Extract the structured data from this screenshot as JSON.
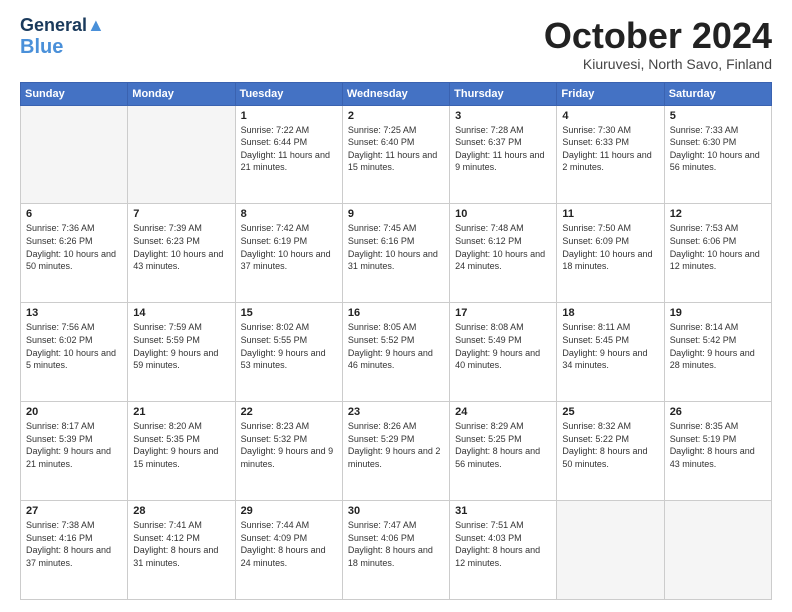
{
  "logo": {
    "line1": "General",
    "line2": "Blue"
  },
  "title": "October 2024",
  "subtitle": "Kiuruvesi, North Savo, Finland",
  "days_header": [
    "Sunday",
    "Monday",
    "Tuesday",
    "Wednesday",
    "Thursday",
    "Friday",
    "Saturday"
  ],
  "weeks": [
    [
      {
        "day": "",
        "text": ""
      },
      {
        "day": "",
        "text": ""
      },
      {
        "day": "1",
        "text": "Sunrise: 7:22 AM\nSunset: 6:44 PM\nDaylight: 11 hours and 21 minutes."
      },
      {
        "day": "2",
        "text": "Sunrise: 7:25 AM\nSunset: 6:40 PM\nDaylight: 11 hours and 15 minutes."
      },
      {
        "day": "3",
        "text": "Sunrise: 7:28 AM\nSunset: 6:37 PM\nDaylight: 11 hours and 9 minutes."
      },
      {
        "day": "4",
        "text": "Sunrise: 7:30 AM\nSunset: 6:33 PM\nDaylight: 11 hours and 2 minutes."
      },
      {
        "day": "5",
        "text": "Sunrise: 7:33 AM\nSunset: 6:30 PM\nDaylight: 10 hours and 56 minutes."
      }
    ],
    [
      {
        "day": "6",
        "text": "Sunrise: 7:36 AM\nSunset: 6:26 PM\nDaylight: 10 hours and 50 minutes."
      },
      {
        "day": "7",
        "text": "Sunrise: 7:39 AM\nSunset: 6:23 PM\nDaylight: 10 hours and 43 minutes."
      },
      {
        "day": "8",
        "text": "Sunrise: 7:42 AM\nSunset: 6:19 PM\nDaylight: 10 hours and 37 minutes."
      },
      {
        "day": "9",
        "text": "Sunrise: 7:45 AM\nSunset: 6:16 PM\nDaylight: 10 hours and 31 minutes."
      },
      {
        "day": "10",
        "text": "Sunrise: 7:48 AM\nSunset: 6:12 PM\nDaylight: 10 hours and 24 minutes."
      },
      {
        "day": "11",
        "text": "Sunrise: 7:50 AM\nSunset: 6:09 PM\nDaylight: 10 hours and 18 minutes."
      },
      {
        "day": "12",
        "text": "Sunrise: 7:53 AM\nSunset: 6:06 PM\nDaylight: 10 hours and 12 minutes."
      }
    ],
    [
      {
        "day": "13",
        "text": "Sunrise: 7:56 AM\nSunset: 6:02 PM\nDaylight: 10 hours and 5 minutes."
      },
      {
        "day": "14",
        "text": "Sunrise: 7:59 AM\nSunset: 5:59 PM\nDaylight: 9 hours and 59 minutes."
      },
      {
        "day": "15",
        "text": "Sunrise: 8:02 AM\nSunset: 5:55 PM\nDaylight: 9 hours and 53 minutes."
      },
      {
        "day": "16",
        "text": "Sunrise: 8:05 AM\nSunset: 5:52 PM\nDaylight: 9 hours and 46 minutes."
      },
      {
        "day": "17",
        "text": "Sunrise: 8:08 AM\nSunset: 5:49 PM\nDaylight: 9 hours and 40 minutes."
      },
      {
        "day": "18",
        "text": "Sunrise: 8:11 AM\nSunset: 5:45 PM\nDaylight: 9 hours and 34 minutes."
      },
      {
        "day": "19",
        "text": "Sunrise: 8:14 AM\nSunset: 5:42 PM\nDaylight: 9 hours and 28 minutes."
      }
    ],
    [
      {
        "day": "20",
        "text": "Sunrise: 8:17 AM\nSunset: 5:39 PM\nDaylight: 9 hours and 21 minutes."
      },
      {
        "day": "21",
        "text": "Sunrise: 8:20 AM\nSunset: 5:35 PM\nDaylight: 9 hours and 15 minutes."
      },
      {
        "day": "22",
        "text": "Sunrise: 8:23 AM\nSunset: 5:32 PM\nDaylight: 9 hours and 9 minutes."
      },
      {
        "day": "23",
        "text": "Sunrise: 8:26 AM\nSunset: 5:29 PM\nDaylight: 9 hours and 2 minutes."
      },
      {
        "day": "24",
        "text": "Sunrise: 8:29 AM\nSunset: 5:25 PM\nDaylight: 8 hours and 56 minutes."
      },
      {
        "day": "25",
        "text": "Sunrise: 8:32 AM\nSunset: 5:22 PM\nDaylight: 8 hours and 50 minutes."
      },
      {
        "day": "26",
        "text": "Sunrise: 8:35 AM\nSunset: 5:19 PM\nDaylight: 8 hours and 43 minutes."
      }
    ],
    [
      {
        "day": "27",
        "text": "Sunrise: 7:38 AM\nSunset: 4:16 PM\nDaylight: 8 hours and 37 minutes."
      },
      {
        "day": "28",
        "text": "Sunrise: 7:41 AM\nSunset: 4:12 PM\nDaylight: 8 hours and 31 minutes."
      },
      {
        "day": "29",
        "text": "Sunrise: 7:44 AM\nSunset: 4:09 PM\nDaylight: 8 hours and 24 minutes."
      },
      {
        "day": "30",
        "text": "Sunrise: 7:47 AM\nSunset: 4:06 PM\nDaylight: 8 hours and 18 minutes."
      },
      {
        "day": "31",
        "text": "Sunrise: 7:51 AM\nSunset: 4:03 PM\nDaylight: 8 hours and 12 minutes."
      },
      {
        "day": "",
        "text": ""
      },
      {
        "day": "",
        "text": ""
      }
    ]
  ]
}
